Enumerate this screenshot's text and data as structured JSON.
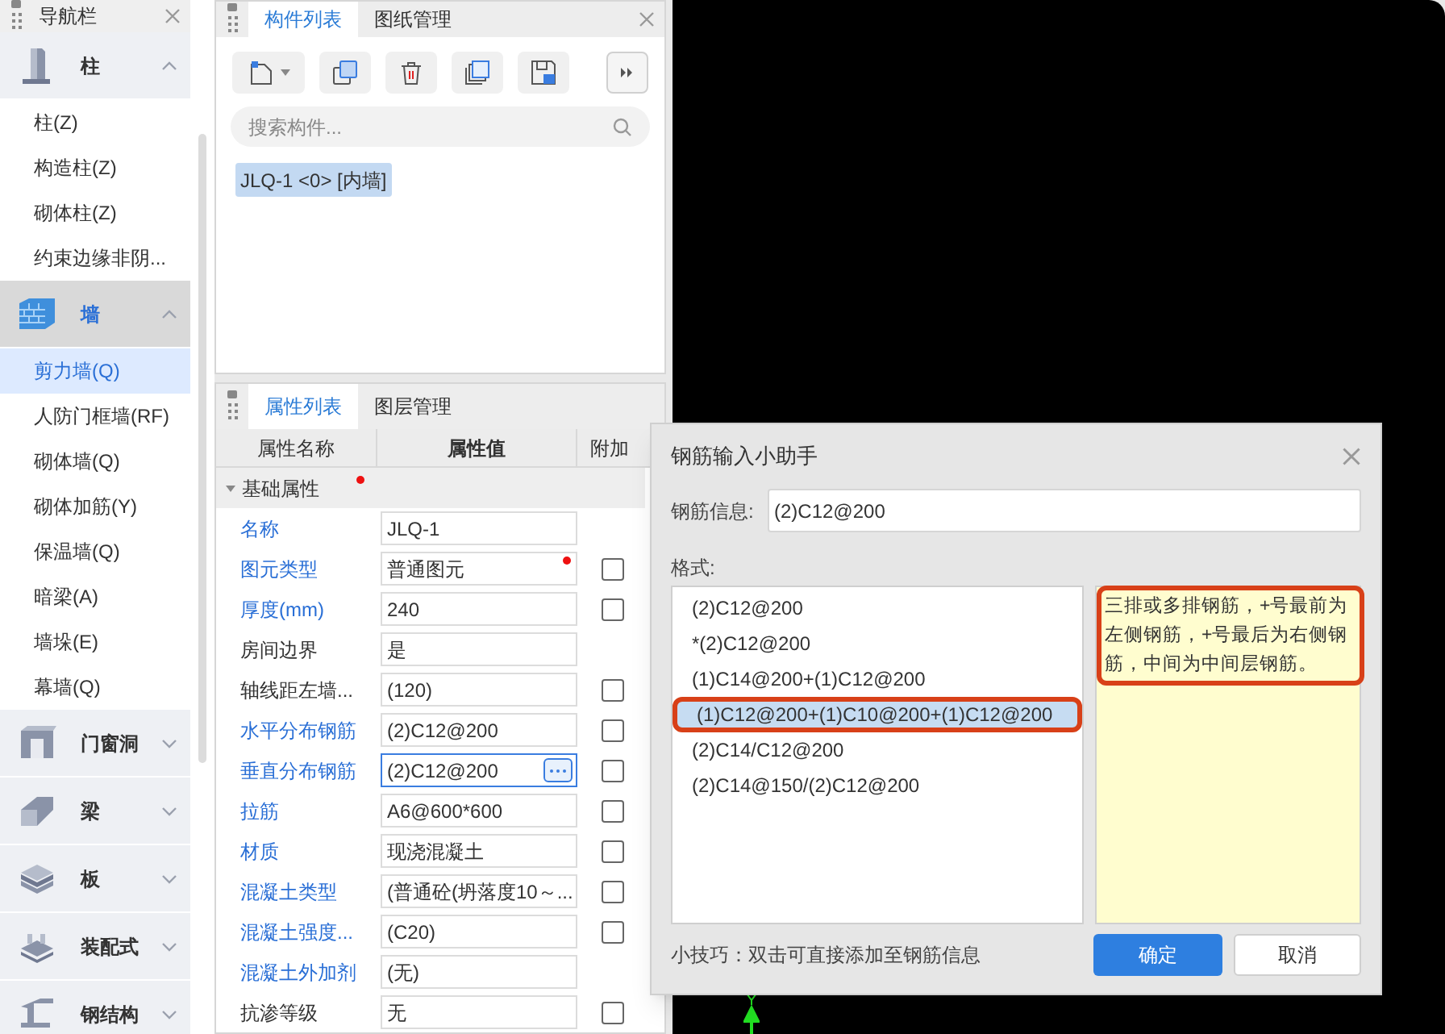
{
  "nav": {
    "title": "导航栏",
    "categories": [
      {
        "label": "柱",
        "kind": "column",
        "selected": false,
        "expanded": true,
        "items": [
          {
            "label": "柱(Z)",
            "selected": false
          },
          {
            "label": "构造柱(Z)",
            "selected": false
          },
          {
            "label": "砌体柱(Z)",
            "selected": false
          },
          {
            "label": "约束边缘非阴...",
            "selected": false
          }
        ]
      },
      {
        "label": "墙",
        "kind": "wall",
        "selected": true,
        "expanded": true,
        "items": [
          {
            "label": "剪力墙(Q)",
            "selected": true
          },
          {
            "label": "人防门框墙(RF)",
            "selected": false
          },
          {
            "label": "砌体墙(Q)",
            "selected": false
          },
          {
            "label": "砌体加筋(Y)",
            "selected": false
          },
          {
            "label": "保温墙(Q)",
            "selected": false
          },
          {
            "label": "暗梁(A)",
            "selected": false
          },
          {
            "label": "墙垛(E)",
            "selected": false
          },
          {
            "label": "幕墙(Q)",
            "selected": false
          }
        ]
      },
      {
        "label": "门窗洞",
        "kind": "opening",
        "selected": false,
        "expanded": false
      },
      {
        "label": "梁",
        "kind": "beam",
        "selected": false,
        "expanded": false
      },
      {
        "label": "板",
        "kind": "slab",
        "selected": false,
        "expanded": false
      },
      {
        "label": "装配式",
        "kind": "prefab",
        "selected": false,
        "expanded": false
      },
      {
        "label": "钢结构",
        "kind": "steel",
        "selected": false,
        "expanded": false
      }
    ]
  },
  "component_panel": {
    "tabs": [
      {
        "label": "构件列表",
        "selected": true
      },
      {
        "label": "图纸管理",
        "selected": false
      }
    ],
    "search": {
      "placeholder": "搜索构件..."
    },
    "items": [
      {
        "label": "JLQ-1 <0> [内墙]",
        "selected": true
      }
    ]
  },
  "property_panel": {
    "tabs": [
      {
        "label": "属性列表",
        "selected": true
      },
      {
        "label": "图层管理",
        "selected": false
      }
    ],
    "columns": [
      "属性名称",
      "属性值",
      "附加"
    ],
    "group": {
      "label": "基础属性",
      "modified": true
    },
    "rows": [
      {
        "name": "名称",
        "value": "JLQ-1",
        "linked": true,
        "modified": false,
        "editing": false
      },
      {
        "name": "图元类型",
        "value": "普通图元",
        "linked": true,
        "checked": false,
        "modified": true,
        "editing": false
      },
      {
        "name": "厚度(mm)",
        "value": "240",
        "linked": true,
        "checked": false,
        "modified": false,
        "editing": false
      },
      {
        "name": "房间边界",
        "value": "是",
        "linked": false,
        "modified": false,
        "editing": false
      },
      {
        "name": "轴线距左墙...",
        "value": "(120)",
        "linked": false,
        "checked": false,
        "modified": false,
        "editing": false
      },
      {
        "name": "水平分布钢筋",
        "value": "(2)C12@200",
        "linked": true,
        "checked": false,
        "modified": false,
        "editing": false
      },
      {
        "name": "垂直分布钢筋",
        "value": "(2)C12@200",
        "linked": true,
        "checked": false,
        "modified": false,
        "editing": true
      },
      {
        "name": "拉筋",
        "value": "A6@600*600",
        "linked": true,
        "checked": false,
        "modified": false,
        "editing": false
      },
      {
        "name": "材质",
        "value": "现浇混凝土",
        "linked": true,
        "checked": false,
        "modified": false,
        "editing": false
      },
      {
        "name": "混凝土类型",
        "value": "(普通砼(坍落度10～...",
        "linked": true,
        "checked": false,
        "modified": false,
        "editing": false
      },
      {
        "name": "混凝土强度...",
        "value": "(C20)",
        "linked": true,
        "checked": false,
        "modified": false,
        "editing": false
      },
      {
        "name": "混凝土外加剂",
        "value": "(无)",
        "linked": true,
        "modified": false,
        "editing": false
      },
      {
        "name": "抗渗等级",
        "value": "无",
        "linked": false,
        "checked": false,
        "modified": false,
        "editing": false
      }
    ]
  },
  "dialog": {
    "title": "钢筋输入小助手",
    "field_label": "钢筋信息:",
    "field_value": "(2)C12@200",
    "formats_label": "格式:",
    "formats": [
      {
        "label": "(2)C12@200",
        "selected": false
      },
      {
        "label": "*(2)C12@200",
        "selected": false
      },
      {
        "label": "(1)C14@200+(1)C12@200",
        "selected": false
      },
      {
        "label": "(1)C12@200+(1)C10@200+(1)C12@200",
        "selected": true
      },
      {
        "label": "(2)C14/C12@200",
        "selected": false
      },
      {
        "label": "(2)C14@150/(2)C12@200",
        "selected": false
      }
    ],
    "description": "三排或多排钢筋，+号最前为左侧钢筋，+号最后为右侧钢筋，中间为中间层钢筋。",
    "tip": "小技巧：双击可直接添加至钢筋信息",
    "buttons": [
      {
        "label": "确定",
        "kind": "primary"
      },
      {
        "label": "取消",
        "kind": "secondary"
      }
    ]
  }
}
